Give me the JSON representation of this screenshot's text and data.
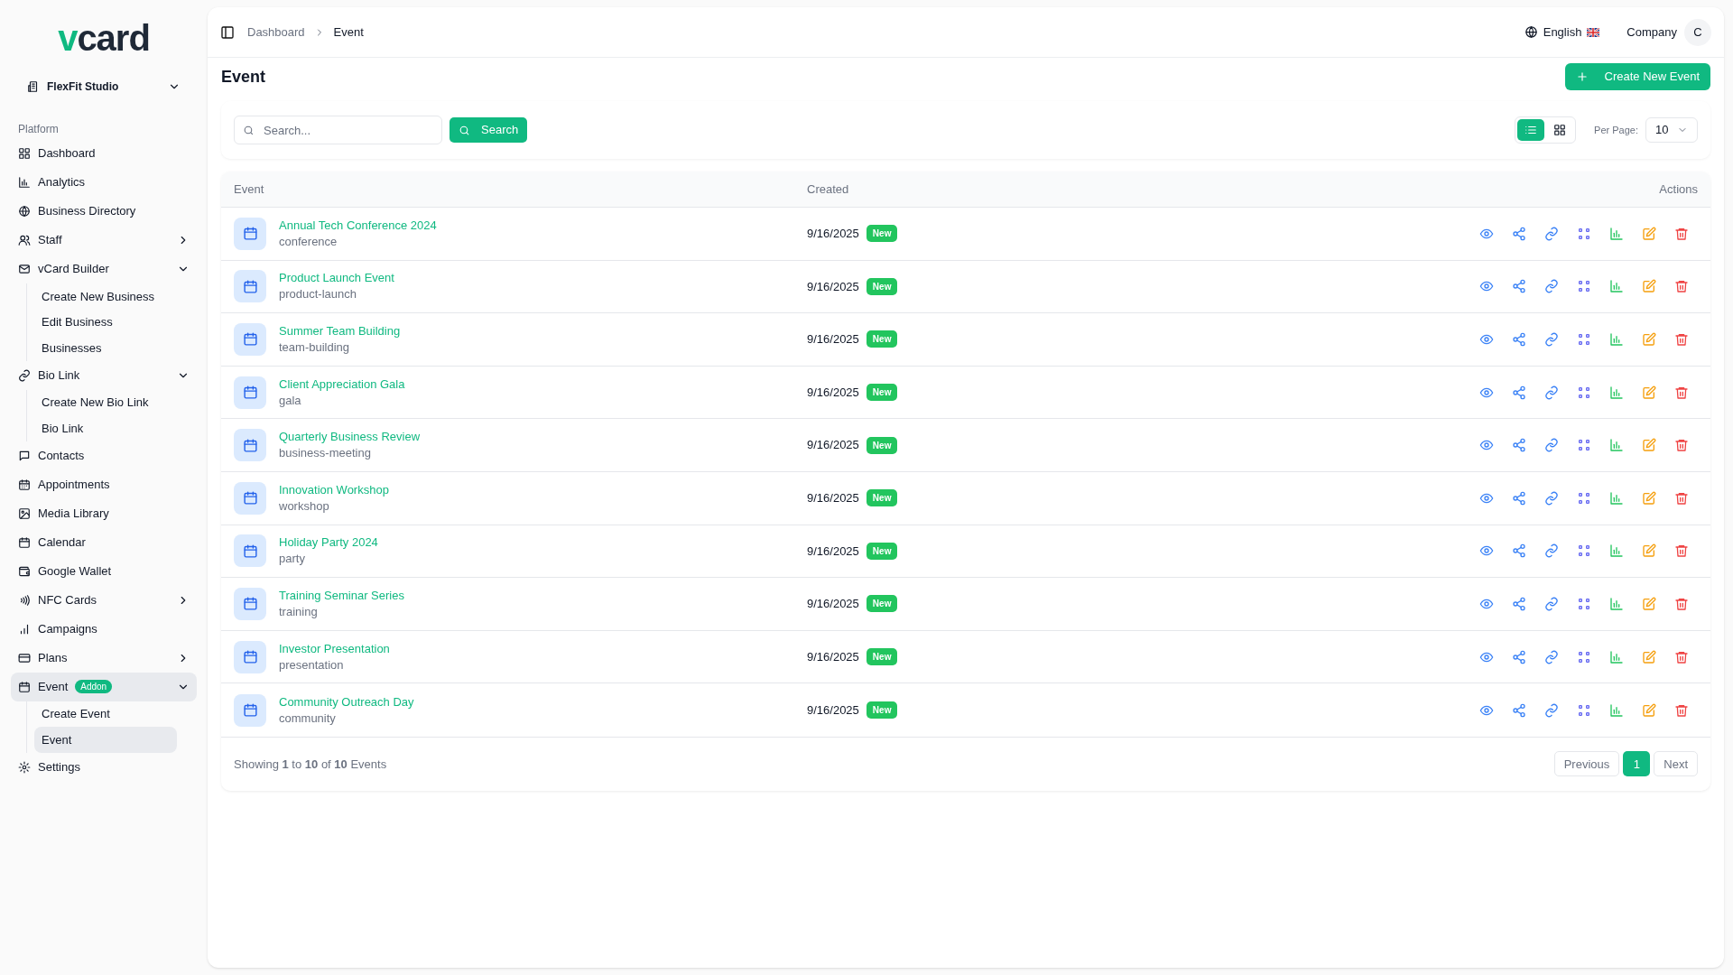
{
  "logo": {
    "text": "vcard"
  },
  "workspace": {
    "name": "FlexFit Studio"
  },
  "sidebar": {
    "section": "Platform",
    "items": [
      {
        "label": "Dashboard",
        "selected": false
      },
      {
        "label": "Analytics",
        "selected": false
      },
      {
        "label": "Business Directory",
        "selected": false
      },
      {
        "label": "Staff",
        "selected": false,
        "expanded": false
      },
      {
        "label": "vCard Builder",
        "selected": false,
        "expanded": true,
        "children": [
          {
            "label": "Create New Business",
            "selected": false
          },
          {
            "label": "Edit Business",
            "selected": false
          },
          {
            "label": "Businesses",
            "selected": false
          }
        ]
      },
      {
        "label": "Bio Link",
        "selected": false,
        "expanded": true,
        "children": [
          {
            "label": "Create New Bio Link",
            "selected": false
          },
          {
            "label": "Bio Link",
            "selected": false
          }
        ]
      },
      {
        "label": "Contacts",
        "selected": false
      },
      {
        "label": "Appointments",
        "selected": false
      },
      {
        "label": "Media Library",
        "selected": false
      },
      {
        "label": "Calendar",
        "selected": false
      },
      {
        "label": "Google Wallet",
        "selected": false
      },
      {
        "label": "NFC Cards",
        "selected": false,
        "expanded": false
      },
      {
        "label": "Campaigns",
        "selected": false
      },
      {
        "label": "Plans",
        "selected": false,
        "expanded": false
      },
      {
        "label": "Event",
        "selected": true,
        "badge": "Addon",
        "expanded": true,
        "children": [
          {
            "label": "Create Event",
            "selected": false
          },
          {
            "label": "Event",
            "selected": true
          }
        ]
      },
      {
        "label": "Settings",
        "selected": false
      }
    ]
  },
  "breadcrumb": [
    "Dashboard",
    "Event"
  ],
  "header": {
    "language": "English",
    "user": "Company",
    "avatar": "C"
  },
  "page_title": "Event",
  "create_button": "Create New Event",
  "search": {
    "placeholder": "Search...",
    "button": "Search"
  },
  "view_modes": [
    {
      "kind": "list",
      "selected": true
    },
    {
      "kind": "grid",
      "selected": false
    }
  ],
  "per_page": {
    "label": "Per Page:",
    "value": "10"
  },
  "table": {
    "columns": [
      "Event",
      "Created",
      "Actions"
    ],
    "rows": [
      {
        "name": "Annual Tech Conference 2024",
        "slug": "conference",
        "created": "9/16/2025",
        "badge": "New"
      },
      {
        "name": "Product Launch Event",
        "slug": "product-launch",
        "created": "9/16/2025",
        "badge": "New"
      },
      {
        "name": "Summer Team Building",
        "slug": "team-building",
        "created": "9/16/2025",
        "badge": "New"
      },
      {
        "name": "Client Appreciation Gala",
        "slug": "gala",
        "created": "9/16/2025",
        "badge": "New"
      },
      {
        "name": "Quarterly Business Review",
        "slug": "business-meeting",
        "created": "9/16/2025",
        "badge": "New"
      },
      {
        "name": "Innovation Workshop",
        "slug": "workshop",
        "created": "9/16/2025",
        "badge": "New"
      },
      {
        "name": "Holiday Party 2024",
        "slug": "party",
        "created": "9/16/2025",
        "badge": "New"
      },
      {
        "name": "Training Seminar Series",
        "slug": "training",
        "created": "9/16/2025",
        "badge": "New"
      },
      {
        "name": "Investor Presentation",
        "slug": "presentation",
        "created": "9/16/2025",
        "badge": "New"
      },
      {
        "name": "Community Outreach Day",
        "slug": "community",
        "created": "9/16/2025",
        "badge": "New"
      }
    ]
  },
  "footer": {
    "summary": "Showing **1** to **10** of **10** Events",
    "pages": [
      {
        "label": "Previous",
        "kind": "prev",
        "selected": false
      },
      {
        "label": "1",
        "kind": "page",
        "selected": true
      },
      {
        "label": "Next",
        "kind": "next",
        "selected": false
      }
    ]
  }
}
